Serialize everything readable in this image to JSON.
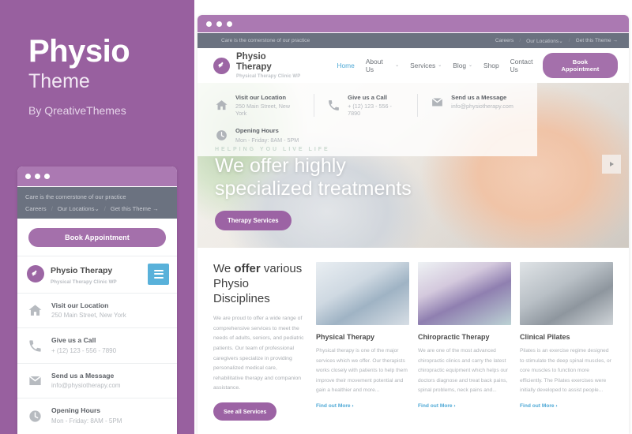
{
  "brand": {
    "title": "Physio",
    "subtitle": "Theme",
    "by": "By QreativeThemes",
    "purple": "#98609f",
    "accent": "#a470ab",
    "blue": "#4fa9d6"
  },
  "topbar": {
    "tagline": "Care is the cornerstone of our practice",
    "links": [
      {
        "label": "Careers",
        "caret": ""
      },
      {
        "label": "Our Locations",
        "caret": "⌄"
      },
      {
        "label": "Get this Theme →",
        "caret": ""
      }
    ],
    "separator": "/"
  },
  "site": {
    "logo_name": "Physio Therapy",
    "logo_tagline": "Physical Therapy Clinic WP",
    "logo_icon": "leaf-icon",
    "menu": [
      {
        "label": "Home",
        "active": true,
        "caret": ""
      },
      {
        "label": "About Us",
        "active": false,
        "caret": "⌄"
      },
      {
        "label": "Services",
        "active": false,
        "caret": "⌄"
      },
      {
        "label": "Blog",
        "active": false,
        "caret": "⌄"
      },
      {
        "label": "Shop",
        "active": false,
        "caret": ""
      },
      {
        "label": "Contact Us",
        "active": false,
        "caret": ""
      }
    ],
    "cta_label": "Book Appointment"
  },
  "contact": [
    {
      "icon": "home-icon",
      "title": "Visit our Location",
      "value": "250 Main Street, New York"
    },
    {
      "icon": "phone-icon",
      "title": "Give us a Call",
      "value": "+ (12) 123 - 556 - 7890"
    },
    {
      "icon": "mail-icon",
      "title": "Send us a Message",
      "value": "info@physiotherapy.com"
    },
    {
      "icon": "clock-icon",
      "title": "Opening Hours",
      "value": "Mon - Friday: 8AM - 5PM"
    }
  ],
  "hero": {
    "kicker": "HELPING YOU LIVE LIFE",
    "line1": "We offer highly",
    "line2": "specialized treatments",
    "button": "Therapy Services",
    "next_icon": "chevron-right-icon"
  },
  "services_intro": {
    "heading_part1": "We ",
    "heading_bold": "offer",
    "heading_part2": " various Physio Disciplines",
    "paragraph": "We are proud to offer a wide range of comprehensive services to meet the needs of adults, seniors, and pediatric patients. Our team of professional caregivers specialize in providing personalized medical care, rehabilitative therapy and companion assistance.",
    "button": "See all Services"
  },
  "service_cards": [
    {
      "title": "Physical Therapy",
      "desc": "Physical therapy is one of the major services which we offer. Our therapists works closely with patients to help them improve their movement potential and gain a healthier and more...",
      "link": "Find out More ›"
    },
    {
      "title": "Chiropractic Therapy",
      "desc": "We are one of the most advanced chiropractic clinics and carry the latest chiropractic equipment which helps our doctors diagnose and treat back pains, spinal problems, neck pains and...",
      "link": "Find out More ›"
    },
    {
      "title": "Clinical Pilates",
      "desc": "Pilates is an exercise regime designed to stimulate the deep spinal muscles, or core muscles to function more efficiently. The Pilates exercises were initially developed to assist people...",
      "link": "Find out More ›"
    }
  ],
  "mobile": {
    "book_label": "Book Appointment",
    "burger_icon": "hamburger-menu-icon"
  }
}
